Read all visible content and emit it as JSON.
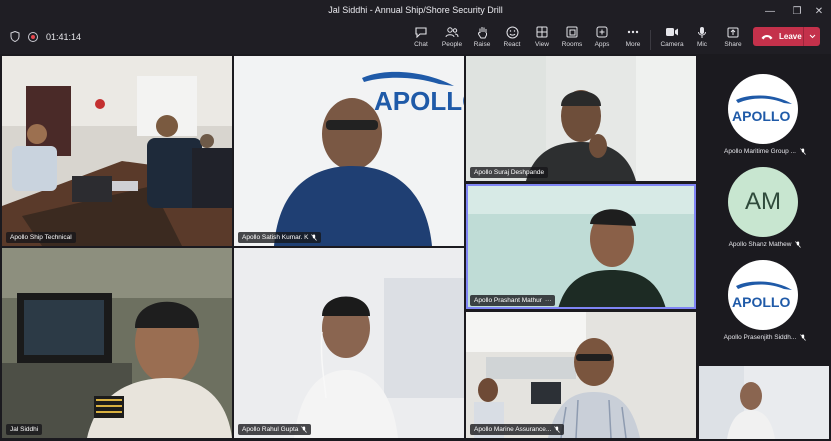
{
  "window": {
    "title": "Jal Siddhi - Annual Ship/Shore Security Drill"
  },
  "status": {
    "timer": "01:41:14"
  },
  "toolbar": {
    "buttons": [
      {
        "label": "Chat"
      },
      {
        "label": "People"
      },
      {
        "label": "Raise"
      },
      {
        "label": "React"
      },
      {
        "label": "View"
      },
      {
        "label": "Rooms"
      },
      {
        "label": "Apps"
      },
      {
        "label": "More"
      },
      {
        "label": "Camera"
      },
      {
        "label": "Mic"
      },
      {
        "label": "Share"
      }
    ],
    "leave_label": "Leave"
  },
  "tiles": [
    {
      "name": "Apollo Ship Technical"
    },
    {
      "name": "Apollo Satish Kumar. K"
    },
    {
      "name": "Apollo Suraj Deshpande"
    },
    {
      "name": "Apollo Prashant Mathur"
    },
    {
      "name": "Jal Siddhi"
    },
    {
      "name": "Apollo Rahul Gupta"
    },
    {
      "name": "Apollo Marine Assurance..."
    }
  ],
  "logo_text": "APOLLO",
  "sidebar": [
    {
      "name": "Apollo Maritime Group ..."
    },
    {
      "name": "Apollo Shanz Mathew",
      "initials": "AM"
    },
    {
      "name": "Apollo Prasenjith Siddh..."
    }
  ],
  "colors": {
    "leave": "#c4314b",
    "active_outline": "#7f85f5",
    "logo_blue": "#1f5aa8"
  }
}
